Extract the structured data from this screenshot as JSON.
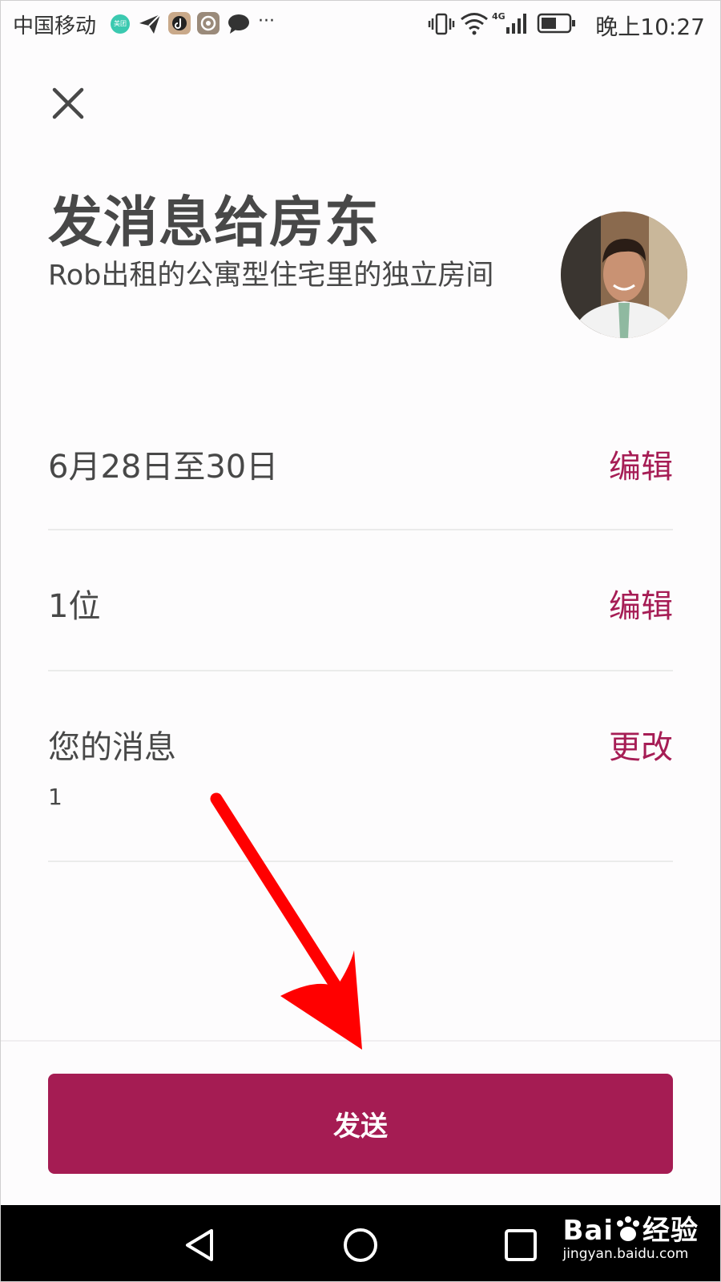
{
  "status_bar": {
    "carrier": "中国移动",
    "meituan_badge": "美团",
    "network": "4G",
    "time": "晚上10:27",
    "more": "···"
  },
  "header": {
    "title": "发消息给房东",
    "subtitle": "Rob出租的公寓型住宅里的独立房间"
  },
  "rows": {
    "dates": {
      "label": "6月28日至30日",
      "action": "编辑"
    },
    "guests": {
      "label": "1位",
      "action": "编辑"
    },
    "message": {
      "label": "您的消息",
      "action": "更改",
      "value": "1"
    }
  },
  "send_button": {
    "label": "发送"
  },
  "watermark": {
    "brand": "Bai",
    "brand_suffix": "经验",
    "url": "jingyan.baidu.com"
  },
  "colors": {
    "accent": "#a61d55",
    "button": "#a51c53",
    "text": "#484848",
    "annotation_arrow": "#ff0000"
  },
  "icons": {
    "close": "close-icon",
    "avatar": "host-avatar",
    "nav_back": "back-triangle-icon",
    "nav_home": "home-circle-icon",
    "nav_recents": "recents-square-icon"
  }
}
